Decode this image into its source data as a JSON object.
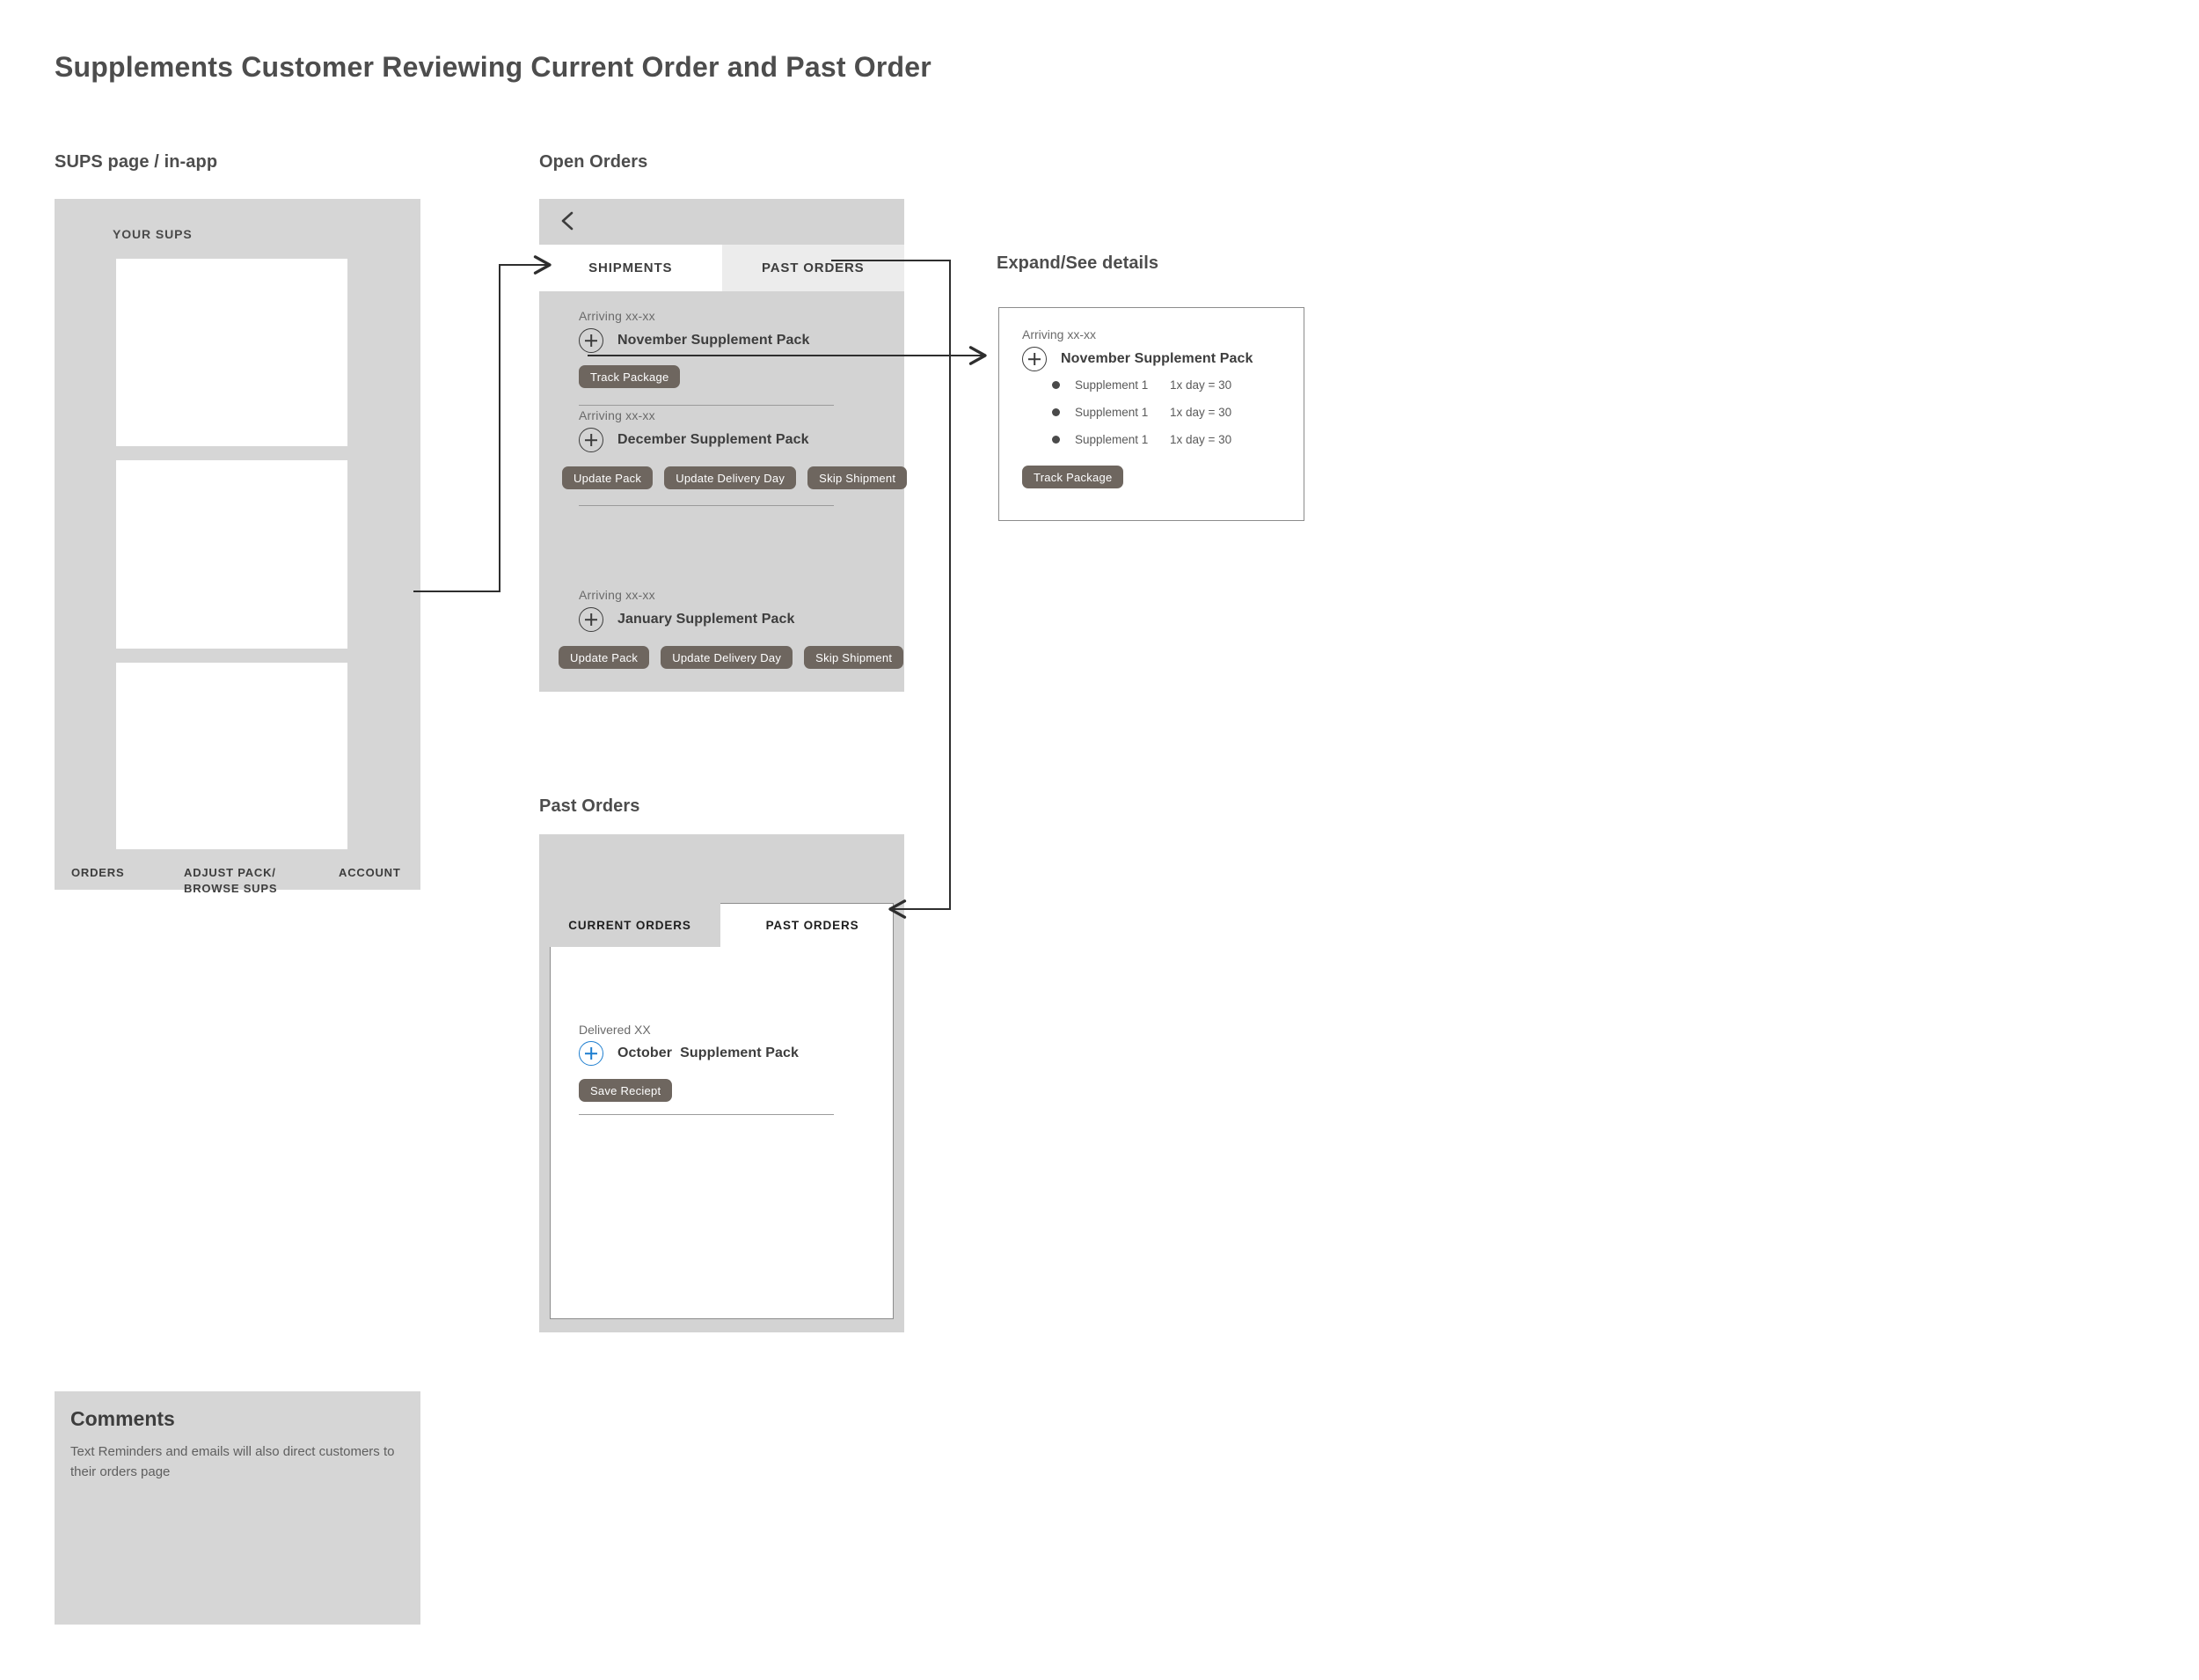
{
  "page": {
    "title": "Supplements Customer Reviewing Current Order and Past Order"
  },
  "sections": {
    "sups": "SUPS page / in-app",
    "open_orders": "Open Orders",
    "expand": "Expand/See details",
    "past_orders": "Past Orders"
  },
  "sups_page": {
    "heading": "YOUR SUPS",
    "cards": [
      "",
      "",
      ""
    ],
    "bottom_nav": [
      {
        "label": "ORDERS"
      },
      {
        "label": "ADJUST PACK/\nBROWSE SUPS"
      },
      {
        "label": "ACCOUNT"
      }
    ]
  },
  "open_orders": {
    "back_icon": "chevron-left-icon",
    "tabs": [
      {
        "label": "SHIPMENTS",
        "active": true
      },
      {
        "label": "PAST ORDERS",
        "active": false
      }
    ],
    "shipments": [
      {
        "arriving": "Arriving xx-xx",
        "pack": "November Supplement Pack",
        "expand_icon": "plus-circle-icon",
        "actions": [
          "Track Package"
        ]
      },
      {
        "arriving": "Arriving xx-xx",
        "pack": "December Supplement Pack",
        "expand_icon": "plus-circle-icon",
        "actions": [
          "Update Pack",
          "Update Delivery Day",
          "Skip Shipment"
        ]
      },
      {
        "arriving": "Arriving xx-xx",
        "pack": "January Supplement Pack",
        "expand_icon": "plus-circle-icon",
        "actions": [
          "Update Pack",
          "Update Delivery Day",
          "Skip Shipment"
        ]
      }
    ]
  },
  "expand_details": {
    "arriving": "Arriving xx-xx",
    "pack": "November Supplement Pack",
    "expand_icon": "plus-circle-icon",
    "items": [
      {
        "name": "Supplement 1",
        "dose": "1x day = 30"
      },
      {
        "name": "Supplement 1",
        "dose": "1x day = 30"
      },
      {
        "name": "Supplement 1",
        "dose": "1x day = 30"
      }
    ],
    "action": "Track Package"
  },
  "past_orders": {
    "tabs": [
      {
        "label": "CURRENT ORDERS",
        "active": false
      },
      {
        "label": "PAST ORDERS",
        "active": true
      }
    ],
    "orders": [
      {
        "delivered": "Delivered XX",
        "pack": "October  Supplement Pack",
        "expand_icon": "plus-circle-icon",
        "action": "Save Reciept"
      }
    ]
  },
  "comments": {
    "title": "Comments",
    "body": "Text Reminders and emails will also direct customers to their orders page"
  },
  "colors": {
    "panel_gray": "#d3d3d3",
    "frame_gray": "#d6d6d6",
    "tab_inactive": "#ececec",
    "button_brown": "#6e665f",
    "accent_blue": "#1f7fd0",
    "text_dark": "#3d3d3d",
    "text_muted": "#6a6a6a",
    "connector": "#2e2e2e"
  }
}
